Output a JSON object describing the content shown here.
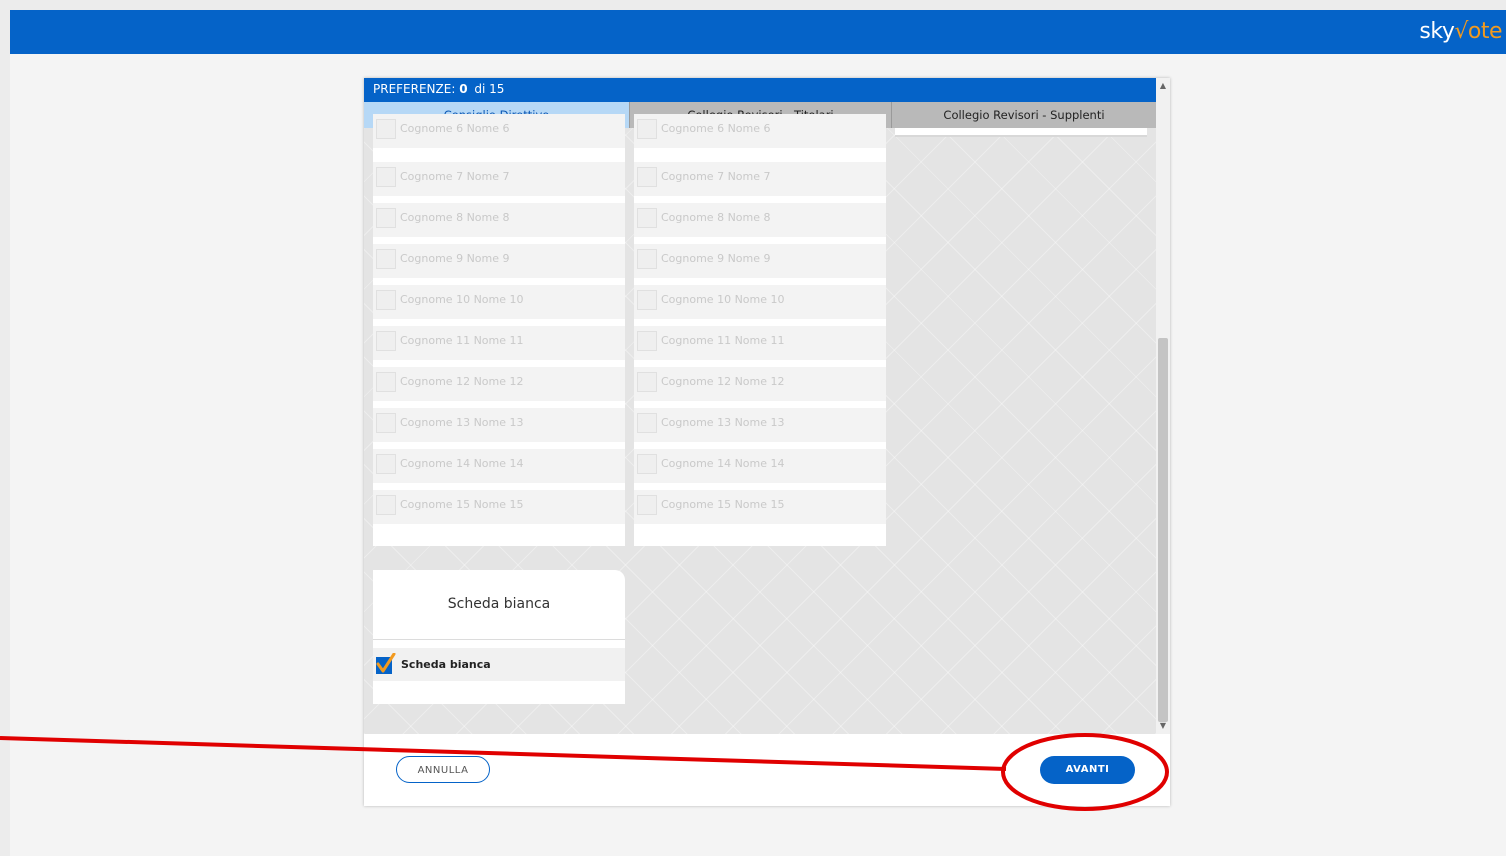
{
  "brand": {
    "logo_prefix": "sky",
    "logo_check": "√",
    "logo_suffix": "ote"
  },
  "preferences": {
    "label": "PREFERENZE:",
    "count": "0",
    "suffix": "di 15"
  },
  "tabs": [
    {
      "label": "Consiglio Direttivo",
      "active": true
    },
    {
      "label": "Collegio Revisori - Titolari",
      "active": false
    },
    {
      "label": "Collegio Revisori - Supplenti",
      "active": false
    }
  ],
  "columns": [
    {
      "candidates": [
        "Cognome 6 Nome 6",
        "Cognome 7 Nome 7",
        "Cognome 8 Nome 8",
        "Cognome 9 Nome 9",
        "Cognome 10 Nome 10",
        "Cognome 11 Nome 11",
        "Cognome 12 Nome 12",
        "Cognome 13 Nome 13",
        "Cognome 14 Nome 14",
        "Cognome 15 Nome 15"
      ]
    },
    {
      "candidates": [
        "Cognome 6 Nome 6",
        "Cognome 7 Nome 7",
        "Cognome 8 Nome 8",
        "Cognome 9 Nome 9",
        "Cognome 10 Nome 10",
        "Cognome 11 Nome 11",
        "Cognome 12 Nome 12",
        "Cognome 13 Nome 13",
        "Cognome 14 Nome 14",
        "Cognome 15 Nome 15"
      ]
    }
  ],
  "blank_ballot": {
    "title": "Scheda bianca",
    "option_label": "Scheda bianca",
    "checked": true
  },
  "footer": {
    "cancel_label": "ANNULLA",
    "next_label": "AVANTI"
  },
  "colors": {
    "primary": "#0563c8",
    "accent": "#f29a1f",
    "annotation": "#e00000"
  }
}
